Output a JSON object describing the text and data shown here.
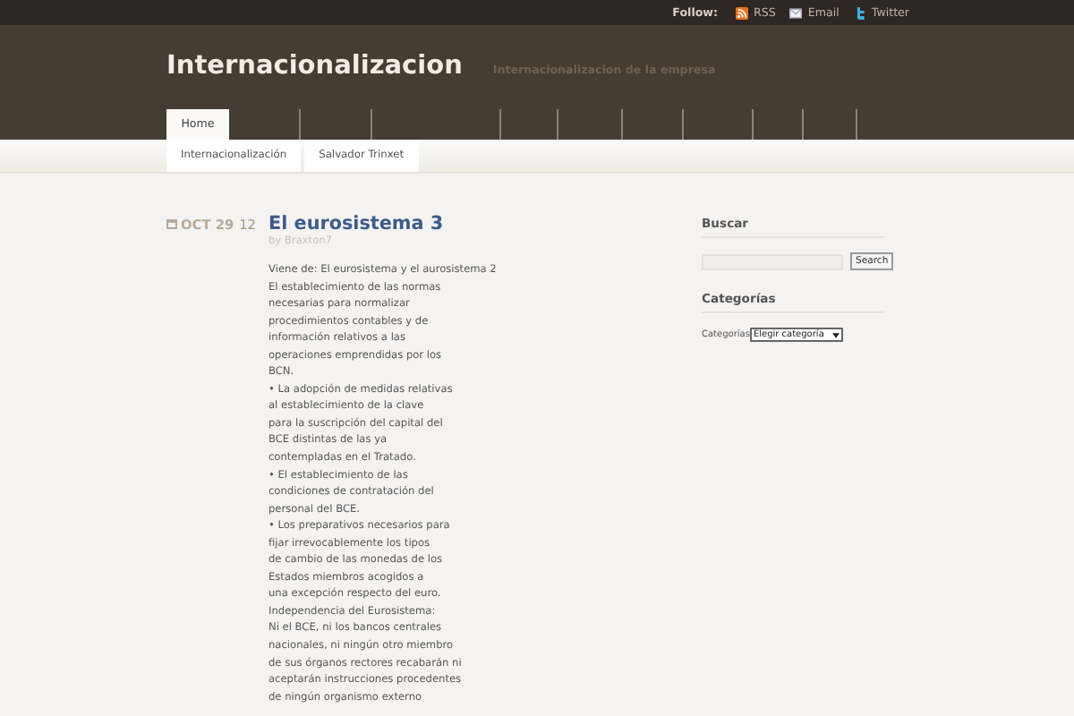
{
  "topbar": {
    "follow_label": "Follow:",
    "links": [
      {
        "label": "RSS",
        "kind": "rss"
      },
      {
        "label": "Email",
        "kind": "email"
      },
      {
        "label": "Twitter",
        "kind": "twitter"
      }
    ]
  },
  "header": {
    "title": "Internacionalizacion",
    "tagline": "Internacionalizacion de la empresa"
  },
  "nav": {
    "items": [
      {
        "label": "Home",
        "selected": true
      }
    ]
  },
  "subnav": {
    "items": [
      "Internacionalización",
      "Salvador Trinxet"
    ]
  },
  "post": {
    "month_day": "OCT 29",
    "year": "12",
    "title": "El eurosistema 3",
    "byline": "by Braxton7",
    "lines": [
      "Viene de: El eurosistema y el aurosistema 2",
      "El establecimiento de las normas",
      "necesarias para normalizar",
      "procedimientos contables y de",
      "información relativos a las",
      "operaciones emprendidas por los",
      "BCN.",
      "• La adopción de medidas relativas",
      "al establecimiento de la clave",
      "para la suscripción del capital del",
      "BCE distintas de las ya",
      "contempladas en el Tratado.",
      "• El establecimiento de las",
      "condiciones de contratación del",
      "personal del BCE.",
      "• Los preparativos necesarios para",
      "fijar irrevocablemente los tipos",
      "de cambio de las monedas de los",
      "Estados miembros acogidos a",
      "una excepción respecto del euro.",
      "Independencia del Eurosistema:",
      "Ni el BCE, ni los bancos centrales",
      "nacionales, ni ningún otro miembro",
      "de sus órganos rectores recabarán ni",
      "aceptarán instrucciones procedentes",
      "de ningún organismo externo"
    ]
  },
  "sidebar": {
    "search_heading": "Buscar",
    "search_button": "Search",
    "categories_heading": "Categorías",
    "categories_label": "Categorías",
    "categories_select": "Elegir categoría"
  }
}
